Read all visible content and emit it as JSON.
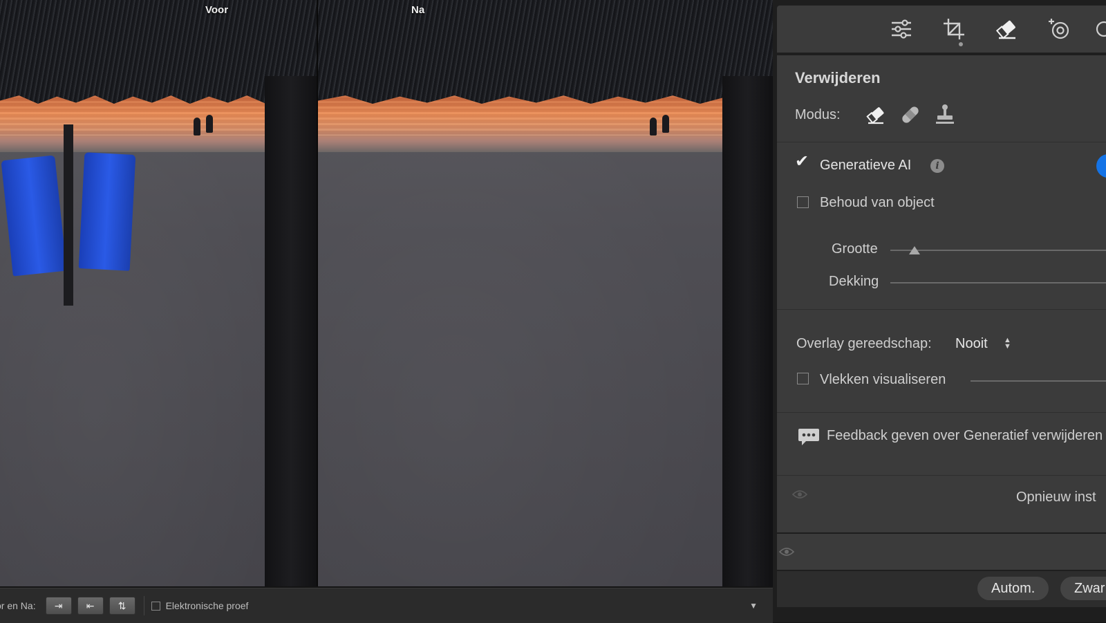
{
  "compare": {
    "before_label": "Voor",
    "after_label": "Na"
  },
  "toolbar": {
    "before_after_label": "or en Na:",
    "proof_label": "Elektronische proef",
    "buttons": [
      "copy-before-to-after-icon",
      "copy-after-to-before-icon",
      "swap-icon"
    ]
  },
  "tools": [
    "edit-sliders-icon",
    "crop-icon",
    "eraser-icon",
    "masking-icon"
  ],
  "remove_panel": {
    "title": "Verwijderen",
    "mode_label": "Modus:",
    "mode_icons": [
      "eraser-icon",
      "bandage-icon",
      "stamp-icon"
    ],
    "generative_ai_label": "Generatieve AI",
    "generative_ai_checked": true,
    "info_glyph": "i",
    "keep_object_label": "Behoud van object",
    "keep_object_checked": false,
    "size_label": "Grootte",
    "size_value": 0.1,
    "opacity_label": "Dekking",
    "opacity_value": 1.0,
    "overlay_label": "Overlay gereedschap:",
    "overlay_value": "Nooit",
    "visualize_label": "Vlekken visualiseren",
    "visualize_checked": false,
    "feedback_label": "Feedback geven over Generatief verwijderen",
    "reset_label": "Opnieuw inst"
  },
  "bottom": {
    "auto_label": "Autom.",
    "bw_label": "Zwar"
  },
  "colors": {
    "panel_bg": "#3b3b3b",
    "accent": "#1473e6"
  }
}
